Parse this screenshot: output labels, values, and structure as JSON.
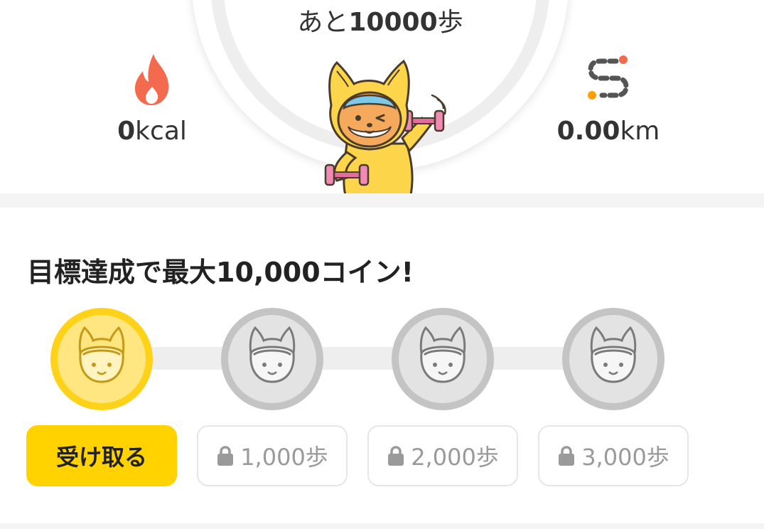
{
  "top": {
    "remaining_prefix": "あと",
    "remaining_value": "10000",
    "remaining_suffix": "歩",
    "calories": {
      "value": "0",
      "unit": "kcal",
      "icon": "flame-icon"
    },
    "distance": {
      "value": "0.00",
      "unit": "km",
      "icon": "route-icon"
    },
    "mascot": "fox-mascot-with-dumbbells"
  },
  "rewards": {
    "headline": "目標達成で最大10,000コイン!",
    "milestones": [
      {
        "medal": "gold-coin-medal",
        "label": "受け取る",
        "locked": false
      },
      {
        "medal": "silver-coin-medal",
        "label": "1,000歩",
        "locked": true
      },
      {
        "medal": "silver-coin-medal",
        "label": "2,000歩",
        "locked": true
      },
      {
        "medal": "silver-coin-medal",
        "label": "3,000歩",
        "locked": true
      }
    ]
  },
  "colors": {
    "accent_yellow": "#ffd200",
    "flame_red": "#f46a4e",
    "locked_gray": "#9a9a9a",
    "track_gray": "#eeeeee"
  }
}
